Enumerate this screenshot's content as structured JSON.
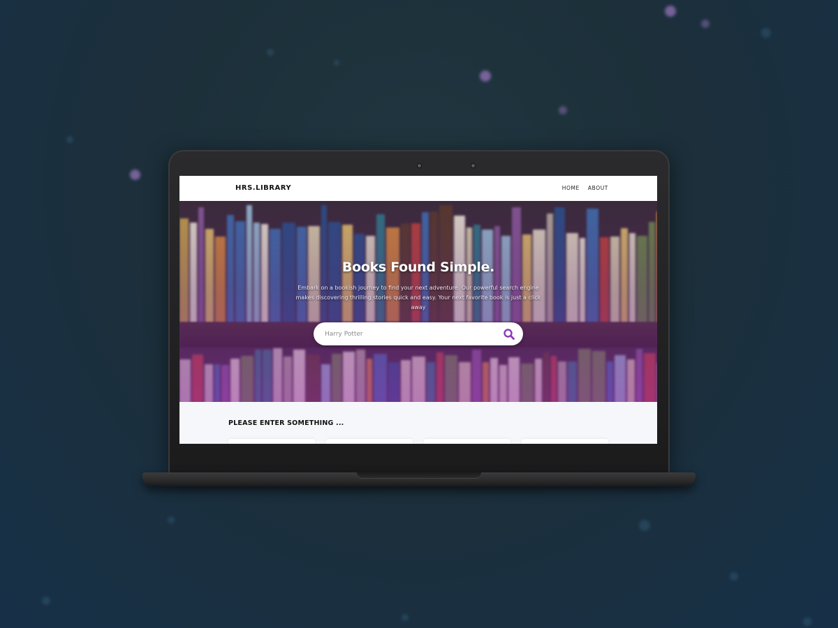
{
  "navbar": {
    "brand": "HRS.LIBRARY",
    "links": [
      {
        "label": "HOME"
      },
      {
        "label": "ABOUT"
      }
    ]
  },
  "hero": {
    "title": "Books Found Simple.",
    "subtitle": "Embark on a bookish journey to find your next adventure. Our powerful search engine makes discovering thrilling stories quick and easy. Your next favorite book is just a click away",
    "search": {
      "placeholder": "Harry Potter",
      "icon": "search-icon"
    }
  },
  "results": {
    "heading": "PLEASE ENTER SOMETHING ..."
  },
  "colors": {
    "accent": "#8e3bb6",
    "background": "#1c2f3a",
    "navbar": "#ffffff",
    "results_bg": "#f5f7fa"
  }
}
